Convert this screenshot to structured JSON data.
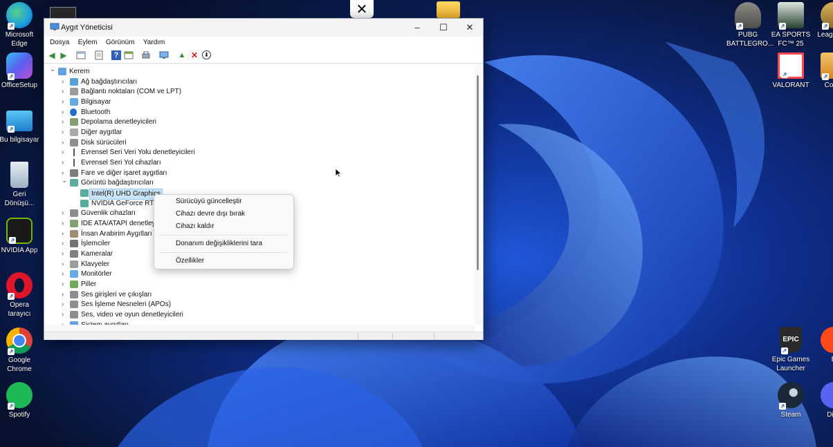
{
  "desktop_left": [
    {
      "id": "edge",
      "label": "Microsoft Edge",
      "icon": "edge-icon",
      "color": "#1b9de2"
    },
    {
      "id": "officesetup",
      "label": "OfficeSetup",
      "icon": "office-icon",
      "color": "#5b7be8"
    },
    {
      "id": "bu-bilgisayar",
      "label": "Bu bilgisayar",
      "icon": "computer-icon",
      "color": "#2aa3e0"
    },
    {
      "id": "geri-donusum",
      "label": "Geri Dönüşü...",
      "icon": "recycle-bin-icon",
      "color": "#9db3c4"
    },
    {
      "id": "nvidia-app",
      "label": "NVIDIA App",
      "icon": "nvidia-icon",
      "color": "#76b900"
    },
    {
      "id": "opera",
      "label": "Opera tarayıcı",
      "icon": "opera-icon",
      "color": "#e0162b"
    },
    {
      "id": "chrome",
      "label": "Google Chrome",
      "icon": "chrome-icon",
      "color": "#db4437"
    },
    {
      "id": "spotify",
      "label": "Spotify",
      "icon": "spotify-icon",
      "color": "#1db954"
    }
  ],
  "desktop_right": [
    {
      "id": "pubg",
      "label": "PUBG BATTLEGRO...",
      "icon": "pubg-icon",
      "color": "#6b6b63"
    },
    {
      "id": "eafc",
      "label": "EA SPORTS FC™ 25",
      "icon": "ea-fc-icon",
      "color": "#28402f"
    },
    {
      "id": "league",
      "label": "Leag Lege",
      "icon": "league-icon",
      "color": "#b08a3a"
    },
    {
      "id": "valorant",
      "label": "VALORANT",
      "icon": "valorant-icon",
      "color": "#ff4655"
    },
    {
      "id": "counter",
      "label": "Count",
      "icon": "counter-strike-icon",
      "color": "#e8a33a"
    },
    {
      "id": "epic",
      "label": "Epic Games Launcher",
      "icon": "epic-games-icon",
      "color": "#2a2a2a"
    },
    {
      "id": "ea",
      "label": "E",
      "icon": "ea-icon",
      "color": "#ff4a1c"
    },
    {
      "id": "steam",
      "label": "Steam",
      "icon": "steam-icon",
      "color": "#1b2838"
    },
    {
      "id": "discord",
      "label": "Disc",
      "icon": "discord-icon",
      "color": "#5865f2"
    }
  ],
  "window": {
    "title": "Aygıt Yöneticisi",
    "menu": [
      "Dosya",
      "Eylem",
      "Görünüm",
      "Yardım"
    ]
  },
  "toolbar": {
    "back": "back-arrow-icon",
    "forward": "forward-arrow-icon",
    "uninstall": "remove-device-icon",
    "scan": "scan-hardware-icon"
  },
  "tree": [
    {
      "label": "Kerem",
      "icon": "computer-icon",
      "expander": "v",
      "level": 0
    },
    {
      "label": "Ağ bağdaştırıcıları",
      "icon": "network-adapter-icon",
      "expander": ">",
      "level": 1
    },
    {
      "label": "Bağlantı noktaları (COM ve LPT)",
      "icon": "port-icon",
      "expander": ">",
      "level": 1
    },
    {
      "label": "Bilgisayar",
      "icon": "monitor-icon",
      "expander": ">",
      "level": 1
    },
    {
      "label": "Bluetooth",
      "icon": "bluetooth-icon",
      "expander": ">",
      "level": 1
    },
    {
      "label": "Depolama denetleyicileri",
      "icon": "storage-controller-icon",
      "expander": ">",
      "level": 1
    },
    {
      "label": "Diğer aygıtlar",
      "icon": "unknown-device-icon",
      "expander": ">",
      "level": 1
    },
    {
      "label": "Disk sürücüleri",
      "icon": "disk-drive-icon",
      "expander": ">",
      "level": 1
    },
    {
      "label": "Evrensel Seri Veri Yolu denetleyicileri",
      "icon": "usb-icon",
      "expander": ">",
      "level": 1
    },
    {
      "label": "Evrensel Seri Yol cihazları",
      "icon": "usb-icon",
      "expander": ">",
      "level": 1
    },
    {
      "label": "Fare ve diğer işaret aygıtları",
      "icon": "mouse-icon",
      "expander": ">",
      "level": 1
    },
    {
      "label": "Görüntü bağdaştırıcıları",
      "icon": "display-adapter-icon",
      "expander": "v",
      "level": 1
    },
    {
      "label": "Intel(R) UHD Graphics",
      "icon": "display-adapter-icon",
      "expander": "",
      "level": 2,
      "selected": true
    },
    {
      "label": "NVIDIA GeForce RTX 4",
      "icon": "display-adapter-icon",
      "expander": "",
      "level": 2
    },
    {
      "label": "Güvenlik cihazları",
      "icon": "security-device-icon",
      "expander": ">",
      "level": 1
    },
    {
      "label": "IDE ATA/ATAPI denetleyicil",
      "icon": "ide-controller-icon",
      "expander": ">",
      "level": 1
    },
    {
      "label": "İnsan Arabirim Aygıtları",
      "icon": "hid-icon",
      "expander": ">",
      "level": 1
    },
    {
      "label": "İşlemciler",
      "icon": "processor-icon",
      "expander": ">",
      "level": 1
    },
    {
      "label": "Kameralar",
      "icon": "camera-icon",
      "expander": ">",
      "level": 1
    },
    {
      "label": "Klavyeler",
      "icon": "keyboard-icon",
      "expander": ">",
      "level": 1
    },
    {
      "label": "Monitörler",
      "icon": "monitor-icon",
      "expander": ">",
      "level": 1
    },
    {
      "label": "Piller",
      "icon": "battery-icon",
      "expander": ">",
      "level": 1
    },
    {
      "label": "Ses girişleri ve çıkışları",
      "icon": "speaker-icon",
      "expander": ">",
      "level": 1
    },
    {
      "label": "Ses İşleme Nesneleri (APOs)",
      "icon": "speaker-icon",
      "expander": ">",
      "level": 1
    },
    {
      "label": "Ses, video ve oyun denetleyicileri",
      "icon": "speaker-icon",
      "expander": ">",
      "level": 1
    },
    {
      "label": "Sistem aygıtları",
      "icon": "system-device-icon",
      "expander": ">",
      "level": 1
    }
  ],
  "context_menu": [
    {
      "label": "Sürücüyü güncelleştir"
    },
    {
      "label": "Cihazı devre dışı bırak"
    },
    {
      "label": "Cihazı kaldır"
    },
    {
      "label": "Donanım değişikliklerini tara"
    },
    {
      "label": "Özellikler"
    }
  ]
}
